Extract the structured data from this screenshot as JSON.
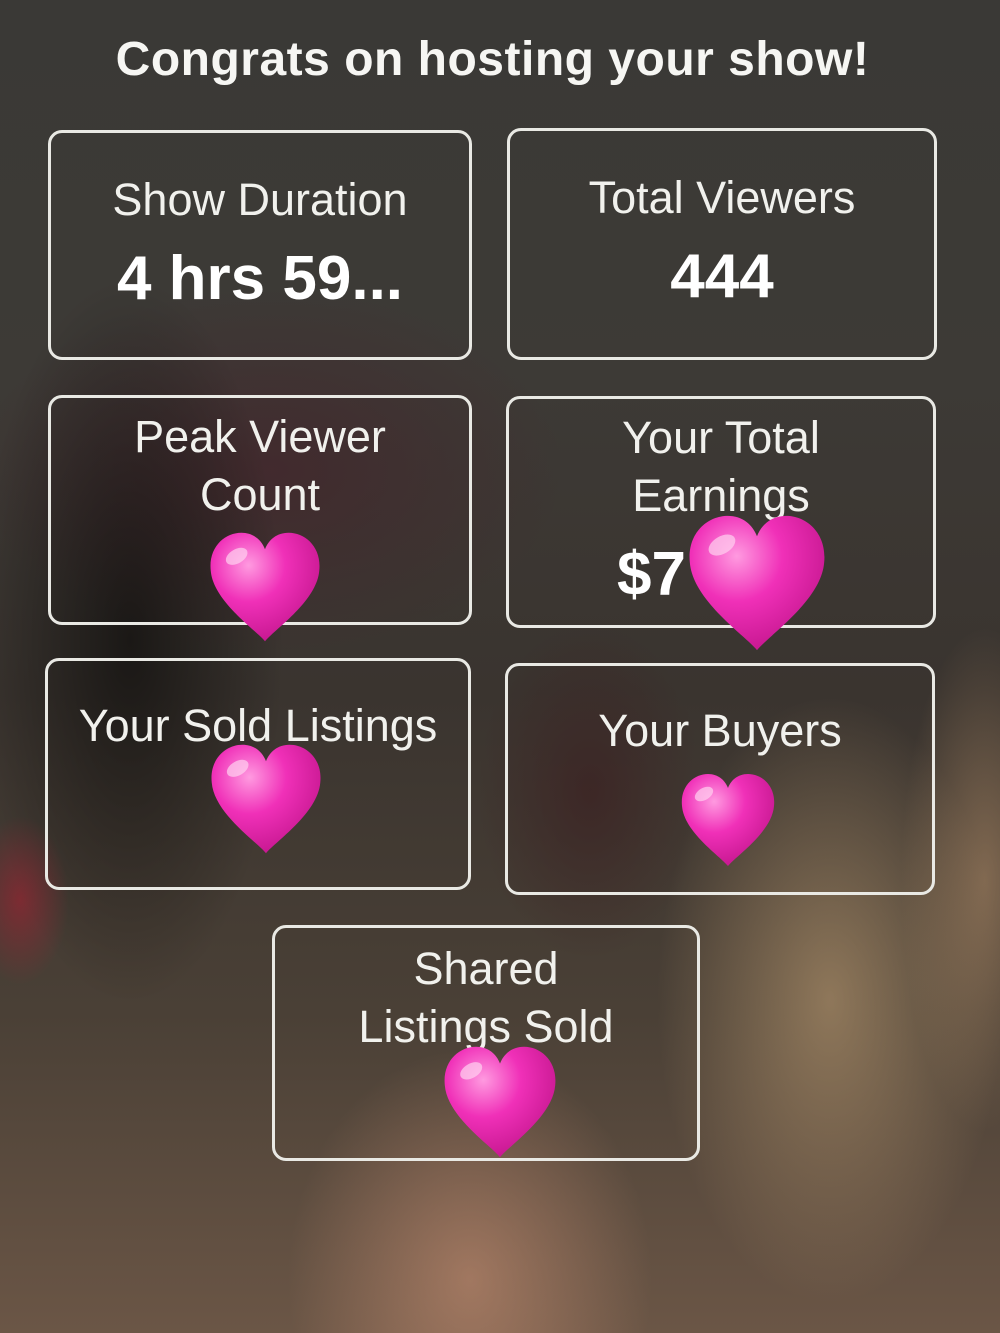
{
  "title": "Congrats on hosting your show!",
  "stats": {
    "show_duration": {
      "label": "Show Duration",
      "value": "4 hrs 59..."
    },
    "total_viewers": {
      "label": "Total Viewers",
      "value": "444"
    },
    "peak_viewer_count": {
      "label_line1": "Peak Viewer",
      "label_line2": "Count"
    },
    "total_earnings": {
      "label_line1": "Your Total",
      "label_line2": "Earnings",
      "value_partial": "$7"
    },
    "sold_listings": {
      "label": "Your Sold Listings"
    },
    "buyers": {
      "label": "Your Buyers"
    },
    "shared_listings_sold": {
      "label_line1": "Shared",
      "label_line2": "Listings Sold"
    }
  },
  "stickers": {
    "icon": "pink-heart-icon",
    "color": "#f030b8"
  }
}
